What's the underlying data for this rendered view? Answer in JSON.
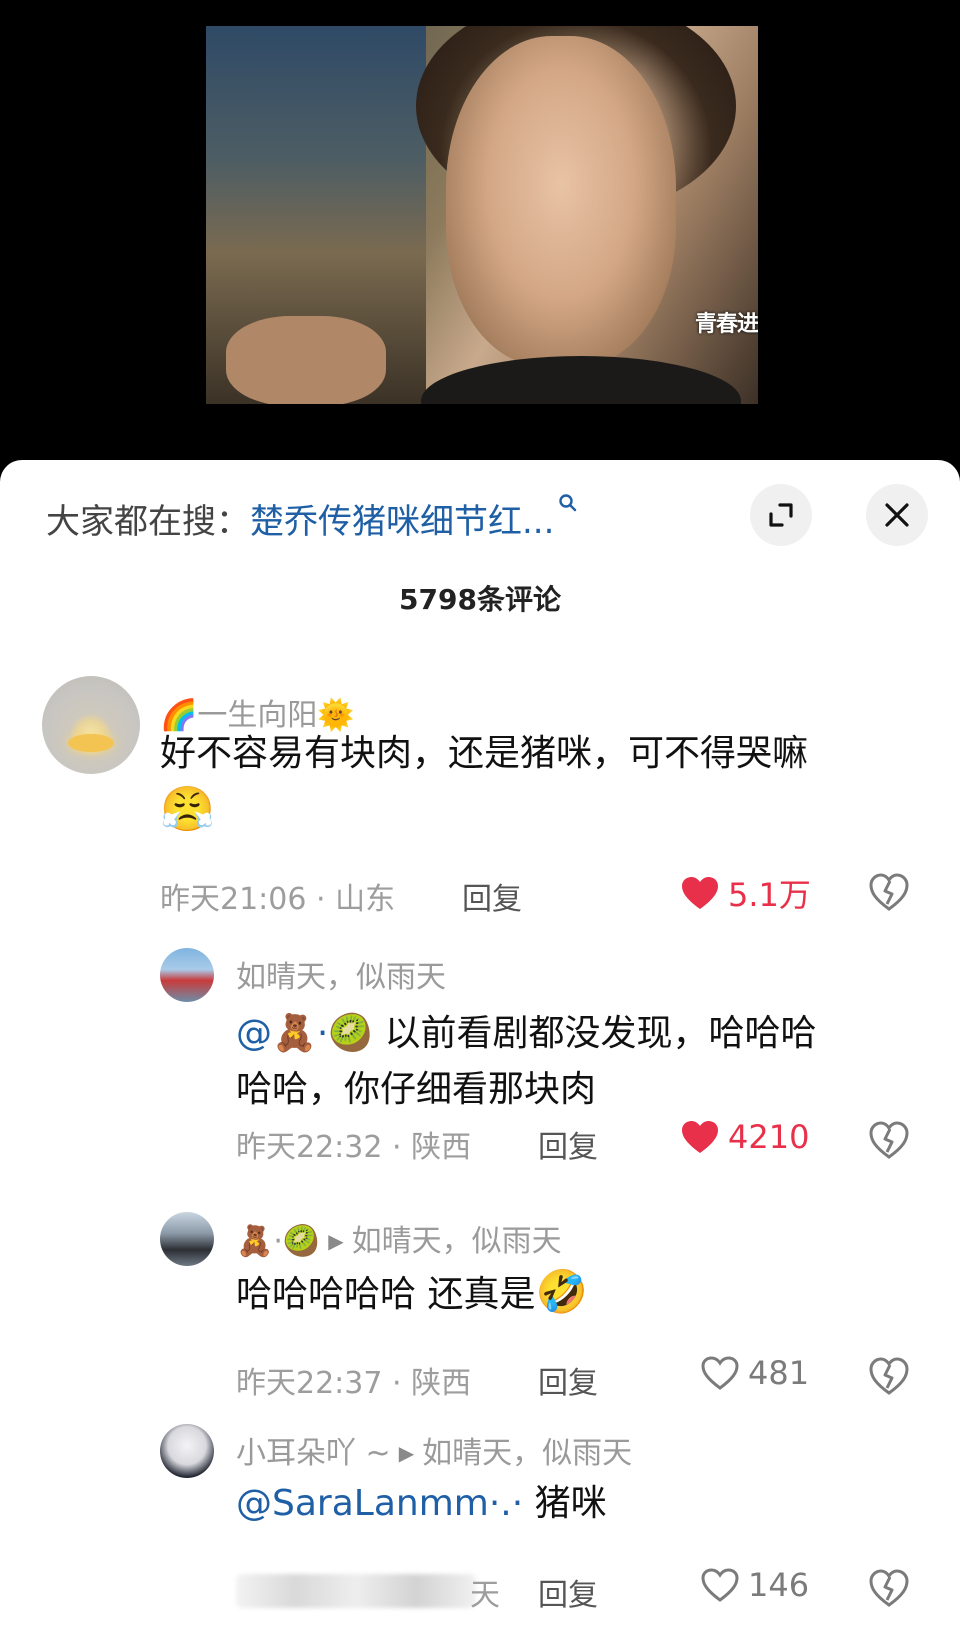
{
  "video": {
    "watermark": "青春进"
  },
  "search": {
    "prefix": "大家都在搜：",
    "term": "楚乔传猪咪细节红..."
  },
  "comments_header": {
    "count_label": "5798条评论"
  },
  "comments": [
    {
      "username": "🌈一生向阳🌞",
      "text": "好不容易有块肉，还是猪咪，可不得哭嘛",
      "emoji": "😤",
      "time_location": "昨天21:06 · 山东",
      "reply": "回复",
      "likes": "5.1万",
      "liked": true
    },
    {
      "username": "如晴天，似雨天",
      "mention": "@🧸·🥝",
      "text_line1": " 以前看剧都没发现，哈哈哈",
      "text_line2": "哈哈，你仔细看那块肉",
      "time_location": "昨天22:32 · 陕西",
      "reply": "回复",
      "likes": "4210",
      "liked": true
    },
    {
      "username": "🧸·🥝",
      "reply_to": "如晴天，似雨天",
      "text": "哈哈哈哈哈 还真是",
      "emoji": "🤣",
      "time_location": "昨天22:37 · 陕西",
      "reply": "回复",
      "likes": "481",
      "liked": false
    },
    {
      "username": "小耳朵吖 ~",
      "reply_to": "如晴天，似雨天",
      "mention": "@SaraLanmm·.·",
      "text": " 猪咪",
      "time_location_visible": "天",
      "reply": "回复",
      "likes": "146",
      "liked": false
    }
  ],
  "colors": {
    "accent_link": "#1f5fa6",
    "like_red": "#e8304a",
    "sheet_bg": "#ffffff"
  }
}
